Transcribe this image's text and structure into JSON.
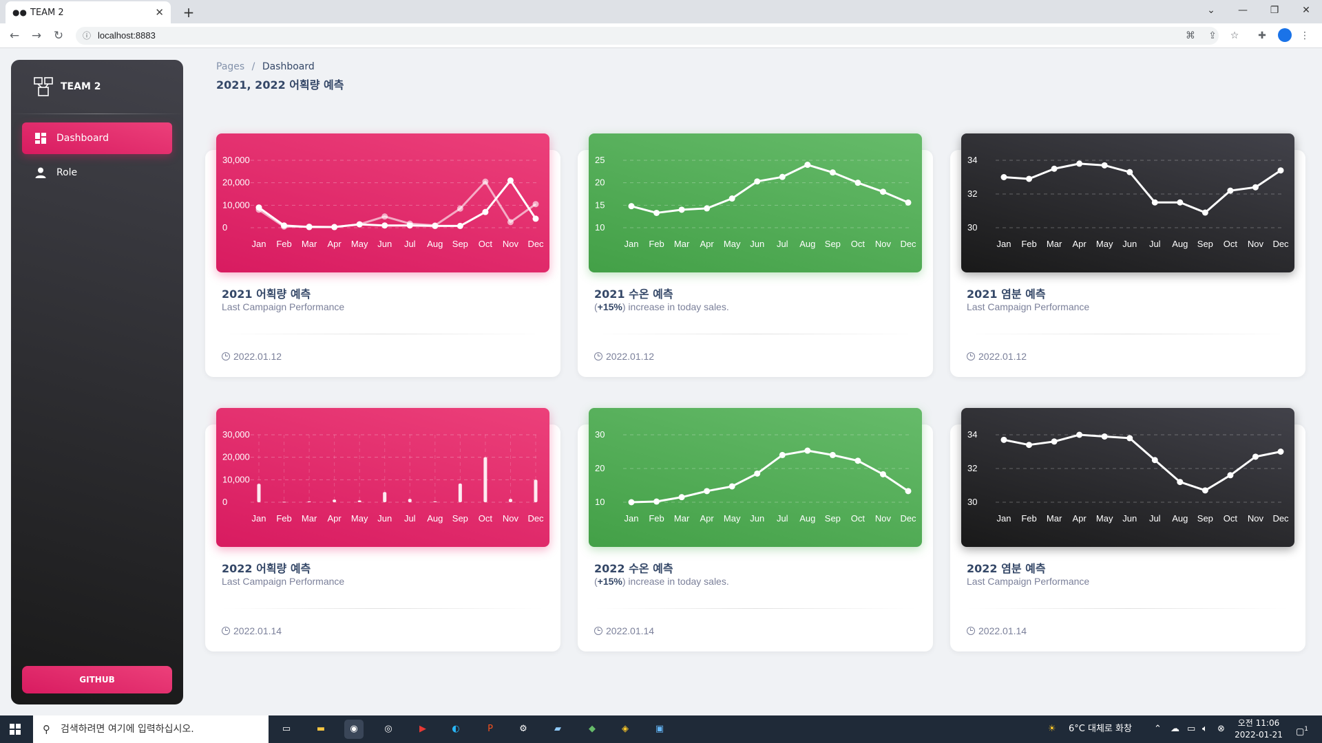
{
  "browser": {
    "tab_title": "TEAM 2",
    "tab_icon": "glasses-icon",
    "url": "localhost:8883"
  },
  "sidebar": {
    "brand": "TEAM 2",
    "items": [
      {
        "label": "Dashboard",
        "icon": "dashboard-icon",
        "active": true
      },
      {
        "label": "Role",
        "icon": "person-icon",
        "active": false
      }
    ],
    "github_label": "GITHUB"
  },
  "header": {
    "breadcrumb_root": "Pages",
    "breadcrumb_sep": "/",
    "breadcrumb_current": "Dashboard",
    "title": "2021, 2022 어획량 예측"
  },
  "cards": [
    {
      "title": "2021 어획량 예측",
      "subtitle": "Last Campaign Performance",
      "date": "2022.01.12",
      "theme": "pink"
    },
    {
      "title": "2021 수온 예측",
      "subtitle_bold": "+15%",
      "subtitle_rest": ") increase in today sales.",
      "subtitle_open": "(",
      "date": "2022.01.12",
      "theme": "green"
    },
    {
      "title": "2021 염분 예측",
      "subtitle": "Last Campaign Performance",
      "date": "2022.01.12",
      "theme": "dark"
    },
    {
      "title": "2022 어획량 예측",
      "subtitle": "Last Campaign Performance",
      "date": "2022.01.14",
      "theme": "pink"
    },
    {
      "title": "2022 수온 예측",
      "subtitle_bold": "+15%",
      "subtitle_rest": ") increase in today sales.",
      "subtitle_open": "(",
      "date": "2022.01.14",
      "theme": "green"
    },
    {
      "title": "2022 염분 예측",
      "subtitle": "Last Campaign Performance",
      "date": "2022.01.14",
      "theme": "dark"
    }
  ],
  "chart_data": [
    {
      "type": "line",
      "categories": [
        "Jan",
        "Feb",
        "Mar",
        "Apr",
        "May",
        "Jun",
        "Jul",
        "Aug",
        "Sep",
        "Oct",
        "Nov",
        "Dec"
      ],
      "series": [
        {
          "values": [
            9000,
            1000,
            300,
            300,
            1500,
            1000,
            1000,
            800,
            800,
            7000,
            21000,
            4000
          ]
        },
        {
          "values": [
            8000,
            500,
            500,
            300,
            1500,
            5000,
            1800,
            1000,
            8500,
            20500,
            2500,
            10500
          ]
        }
      ],
      "ylim": [
        0,
        30000
      ],
      "yticks": [
        "0",
        "10,000",
        "20,000",
        "30,000"
      ],
      "grid": true
    },
    {
      "type": "line",
      "categories": [
        "Jan",
        "Feb",
        "Mar",
        "Apr",
        "May",
        "Jun",
        "Jul",
        "Aug",
        "Sep",
        "Oct",
        "Nov",
        "Dec"
      ],
      "series": [
        {
          "values": [
            14.8,
            13.3,
            14.0,
            14.3,
            16.5,
            20.3,
            21.3,
            24.0,
            22.3,
            20.0,
            18.0,
            15.6
          ]
        }
      ],
      "ylim": [
        10,
        25
      ],
      "yticks": [
        "10",
        "15",
        "20",
        "25"
      ],
      "grid": true
    },
    {
      "type": "line",
      "categories": [
        "Jan",
        "Feb",
        "Mar",
        "Apr",
        "May",
        "Jun",
        "Jul",
        "Aug",
        "Sep",
        "Oct",
        "Nov",
        "Dec"
      ],
      "series": [
        {
          "values": [
            33.0,
            32.9,
            33.5,
            33.8,
            33.7,
            33.3,
            31.5,
            31.5,
            30.9,
            32.2,
            32.4,
            33.4
          ]
        }
      ],
      "ylim": [
        30,
        34
      ],
      "yticks": [
        "30",
        "32",
        "34"
      ],
      "grid": true
    },
    {
      "type": "bar",
      "categories": [
        "Jan",
        "Feb",
        "Mar",
        "Apr",
        "May",
        "Jun",
        "Jul",
        "Aug",
        "Sep",
        "Oct",
        "Nov",
        "Dec"
      ],
      "values": [
        8200,
        200,
        400,
        1200,
        800,
        4500,
        1500,
        400,
        8300,
        20000,
        1500,
        10000
      ],
      "ylim": [
        0,
        30000
      ],
      "yticks": [
        "0",
        "10,000",
        "20,000",
        "30,000"
      ],
      "grid": true
    },
    {
      "type": "line",
      "categories": [
        "Jan",
        "Feb",
        "Mar",
        "Apr",
        "May",
        "Jun",
        "Jul",
        "Aug",
        "Sep",
        "Oct",
        "Nov",
        "Dec"
      ],
      "series": [
        {
          "values": [
            10.0,
            10.2,
            11.5,
            13.3,
            14.7,
            18.5,
            24.0,
            25.3,
            24.0,
            22.3,
            18.3,
            13.3
          ]
        }
      ],
      "ylim": [
        10,
        30
      ],
      "yticks": [
        "10",
        "20",
        "30"
      ],
      "grid": true
    },
    {
      "type": "line",
      "categories": [
        "Jan",
        "Feb",
        "Mar",
        "Apr",
        "May",
        "Jun",
        "Jul",
        "Aug",
        "Sep",
        "Oct",
        "Nov",
        "Dec"
      ],
      "series": [
        {
          "values": [
            33.7,
            33.4,
            33.6,
            34.0,
            33.9,
            33.8,
            32.5,
            31.2,
            30.7,
            31.6,
            32.7,
            33.0
          ]
        }
      ],
      "ylim": [
        30,
        34
      ],
      "yticks": [
        "30",
        "32",
        "34"
      ],
      "grid": true
    }
  ],
  "taskbar": {
    "search_placeholder": "검색하려면 여기에 입력하십시오.",
    "weather": "6°C  대체로 화창",
    "time": "오전 11:06",
    "date": "2022-01-21",
    "notification_count": "1"
  }
}
